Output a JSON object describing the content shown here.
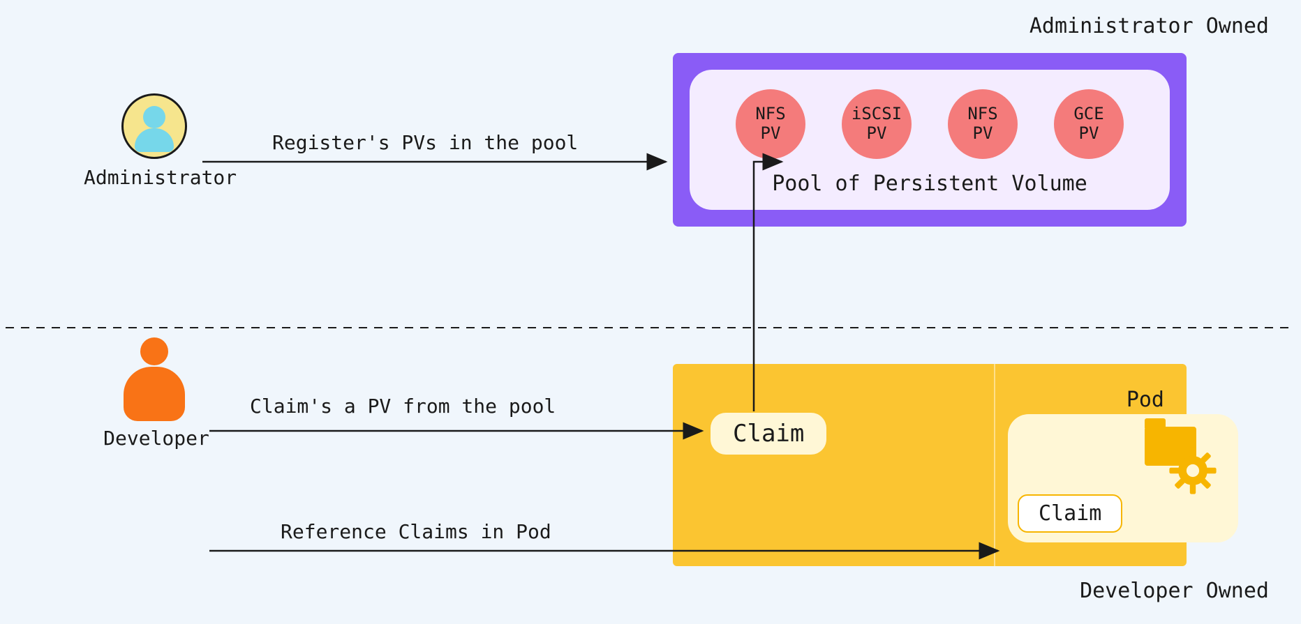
{
  "sections": {
    "admin_owned": "Administrator Owned",
    "dev_owned": "Developer Owned"
  },
  "actors": {
    "administrator": "Administrator",
    "developer": "Developer"
  },
  "arrows": {
    "register": "Register's PVs in the pool",
    "claim_pv": "Claim's a PV from the pool",
    "ref_claims": "Reference Claims in Pod"
  },
  "pool": {
    "title": "Pool of Persistent Volume",
    "pvs": [
      {
        "line1": "NFS",
        "line2": "PV"
      },
      {
        "line1": "iSCSI",
        "line2": "PV"
      },
      {
        "line1": "NFS",
        "line2": "PV"
      },
      {
        "line1": "GCE",
        "line2": "PV"
      }
    ]
  },
  "dev_area": {
    "claim": "Claim",
    "pod_label": "Pod",
    "pod_claim": "Claim"
  }
}
